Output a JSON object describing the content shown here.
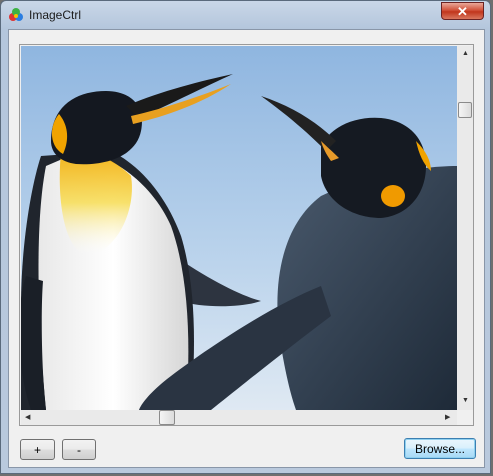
{
  "window": {
    "title": "ImageCtrl",
    "close_icon": "close-icon",
    "app_icon": "app-icon"
  },
  "image": {
    "description_icon": "penguins-image"
  },
  "scrollbars": {
    "vertical_position": 0.18,
    "horizontal_position": 0.33
  },
  "buttons": {
    "zoom_in_label": "+",
    "zoom_out_label": "-",
    "browse_label": "Browse..."
  },
  "colors": {
    "sky": "#a9c8e8",
    "accent": "#3c7fb1"
  }
}
